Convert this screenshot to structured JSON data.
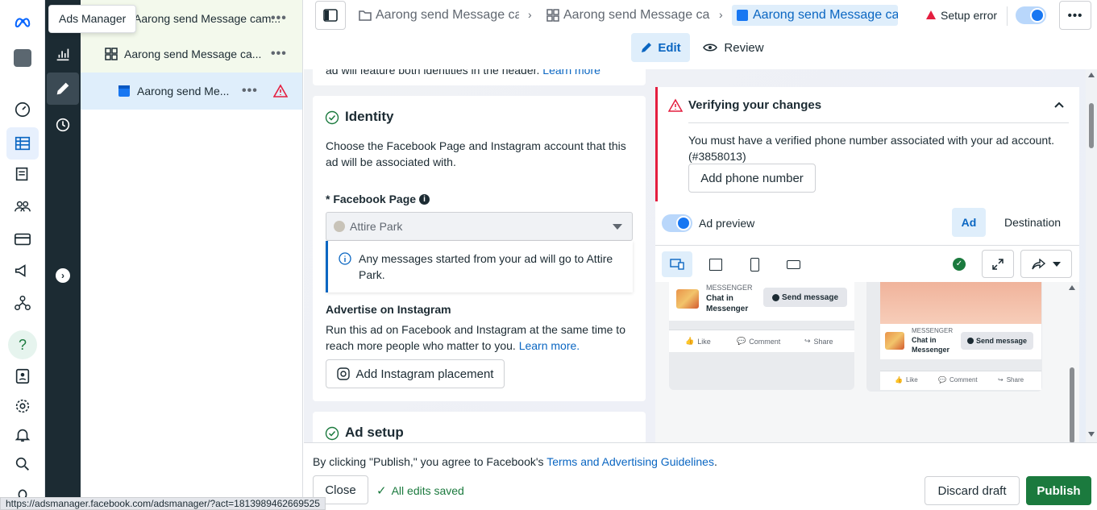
{
  "tooltip": "Ads Manager",
  "tree": {
    "campaign": "Aarong send Message cam...",
    "adset": "Aarong send Message ca...",
    "ad": "Aarong send Me..."
  },
  "breadcrumbs": [
    "Aarong send Message can",
    "Aarong send Message can",
    "Aarong send Message can"
  ],
  "header": {
    "setup_error": "Setup error",
    "edit_tab": "Edit",
    "review_tab": "Review"
  },
  "top_partial_text": "ad will feature both identities in the header.",
  "top_partial_link": "Learn more",
  "identity": {
    "title": "Identity",
    "description": "Choose the Facebook Page and Instagram account that this ad will be associated with.",
    "page_label": "* Facebook Page",
    "page_value": "Attire Park",
    "info_text": "Any messages started from your ad will go to Attire Park.",
    "instagram_title": "Advertise on Instagram",
    "instagram_desc": "Run this ad on Facebook and Instagram at the same time to reach more people who matter to you.",
    "learn_more": "Learn more.",
    "add_instagram": "Add Instagram placement"
  },
  "ad_setup": {
    "title": "Ad setup"
  },
  "verify": {
    "title": "Verifying your changes",
    "message": "You must have a verified phone number associated with your ad account. (#3858013)",
    "button": "Add phone number"
  },
  "preview": {
    "label": "Ad preview",
    "tab_ad": "Ad",
    "tab_destination": "Destination",
    "messenger": "MESSENGER",
    "chat": "Chat in Messenger",
    "send": "Send message",
    "like": "Like",
    "comment": "Comment",
    "share": "Share"
  },
  "footer": {
    "publish_notice_prefix": "By clicking \"Publish,\" you agree to Facebook's",
    "publish_notice_link": "Terms and Advertising Guidelines",
    "close": "Close",
    "saved": "All edits saved",
    "discard": "Discard draft",
    "publish": "Publish"
  },
  "status_url": "https://adsmanager.facebook.com/adsmanager/?act=1813989462669525",
  "colors": {
    "accent": "#1877f2",
    "publish_green": "#1b7a3e",
    "error_red": "#e41e3f",
    "link": "#0a66c2"
  }
}
